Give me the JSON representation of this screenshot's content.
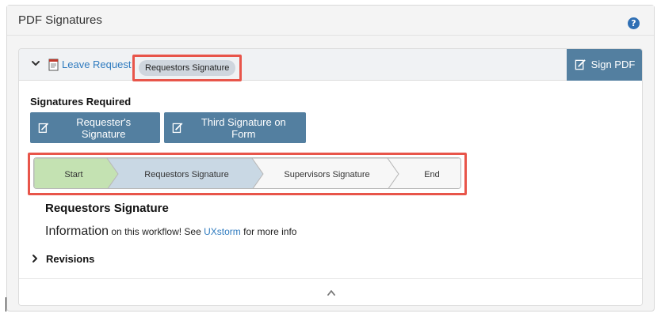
{
  "panel": {
    "title": "PDF Signatures",
    "help_icon": "question-icon"
  },
  "document": {
    "link_text": "Leave Request",
    "tag": "Requestors Signature"
  },
  "toolbar": {
    "sign_pdf_label": "Sign PDF"
  },
  "signatures": {
    "heading": "Signatures Required",
    "buttons": [
      {
        "label": "Requester's Signature"
      },
      {
        "label": "Third Signature on Form"
      }
    ]
  },
  "workflow": {
    "steps": [
      {
        "label": "Start",
        "state": "complete"
      },
      {
        "label": "Requestors Signature",
        "state": "current"
      },
      {
        "label": "Supervisors Signature",
        "state": "pending"
      },
      {
        "label": "End",
        "state": "pending"
      }
    ]
  },
  "body": {
    "title": "Requestors Signature",
    "info_big": "Information",
    "info_mid": " on this workflow!  See ",
    "info_link": "UXstorm",
    "info_end": " for more info"
  },
  "revisions": {
    "label": "Revisions"
  },
  "colors": {
    "accent": "#537fa0",
    "highlight": "#e8554a",
    "complete": "#c4e2b2",
    "current": "#c9d8e4",
    "pending": "#f7f7f7",
    "link": "#2f7bbf"
  }
}
